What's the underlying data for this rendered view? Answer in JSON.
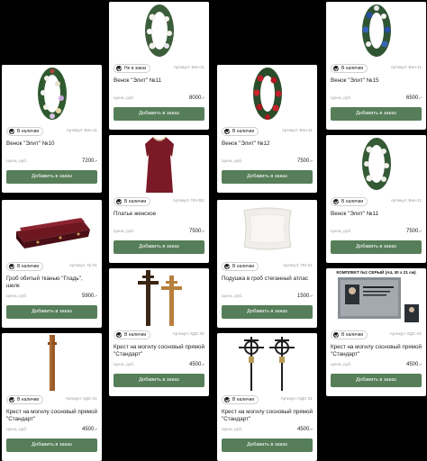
{
  "common": {
    "price_label": "Цена, руб.",
    "button_label": "Добавить в заказ",
    "in_stock": "В наличии",
    "not_in_stock": "Не в заказ"
  },
  "cards": [
    {
      "status": "В наличии",
      "article": "Артикул: Вен-11",
      "title": "Венок \"Элит\" №10",
      "price": "7200.-"
    },
    {
      "status": "Не в заказ",
      "article": "Артикул: Вен-11",
      "title": "Венок \"Элит\" №11",
      "price": "8000.-"
    },
    {
      "status": "В наличии",
      "article": "Артикул: Вен-11",
      "title": "Венок \"Элит\" №12",
      "price": "7500.-"
    },
    {
      "status": "В наличии",
      "article": "Артикул: Вен-11",
      "title": "Венок \"Элит\" №15",
      "price": "6500.-"
    },
    {
      "status": "В наличии",
      "article": "Артикул: ПЛ-002",
      "title": "Платье женское",
      "price": "7500.-"
    },
    {
      "status": "В наличии",
      "article": "Артикул: Вен-11",
      "title": "Венок \"Элит\" №11",
      "price": "7500.-"
    },
    {
      "status": "В наличии",
      "article": "Артикул: Гр-01",
      "title": "Гроб обитый тканью \"Гладь\", шелк",
      "price": "5900.-"
    },
    {
      "status": "В наличии",
      "article": "Артикул: ПН-01",
      "title": "Подушка в гроб стеганный атлас",
      "price": "1500.-"
    },
    {
      "status": "В наличии",
      "article": "Артикул: КДС-01",
      "title": "Крест на могилу сосновый прямой \"Стандарт\"",
      "price": "4500.-"
    },
    {
      "status": "В наличии",
      "article": "Артикул: КДС-01",
      "title": "Крест на могилу сосновый прямой \"Стандарт\"",
      "price": "4500.-"
    },
    {
      "status": "В наличии",
      "article": "Артикул: КДС-01",
      "title": "Крест на могилу сосновый прямой \"Стандарт\"",
      "price": "4500.-"
    },
    {
      "status": "В наличии",
      "article": "Артикул: КДС-01",
      "title": "Крест на могилу сосновый прямой \"Стандарт\"",
      "price": "4500.-"
    }
  ],
  "sign_text": "КОМПЛЕКТ №2 СЕРЫЙ (А4, 30 х 21 см)",
  "colors": {
    "button": "#567e59",
    "background": "#000000",
    "card": "#ffffff"
  }
}
